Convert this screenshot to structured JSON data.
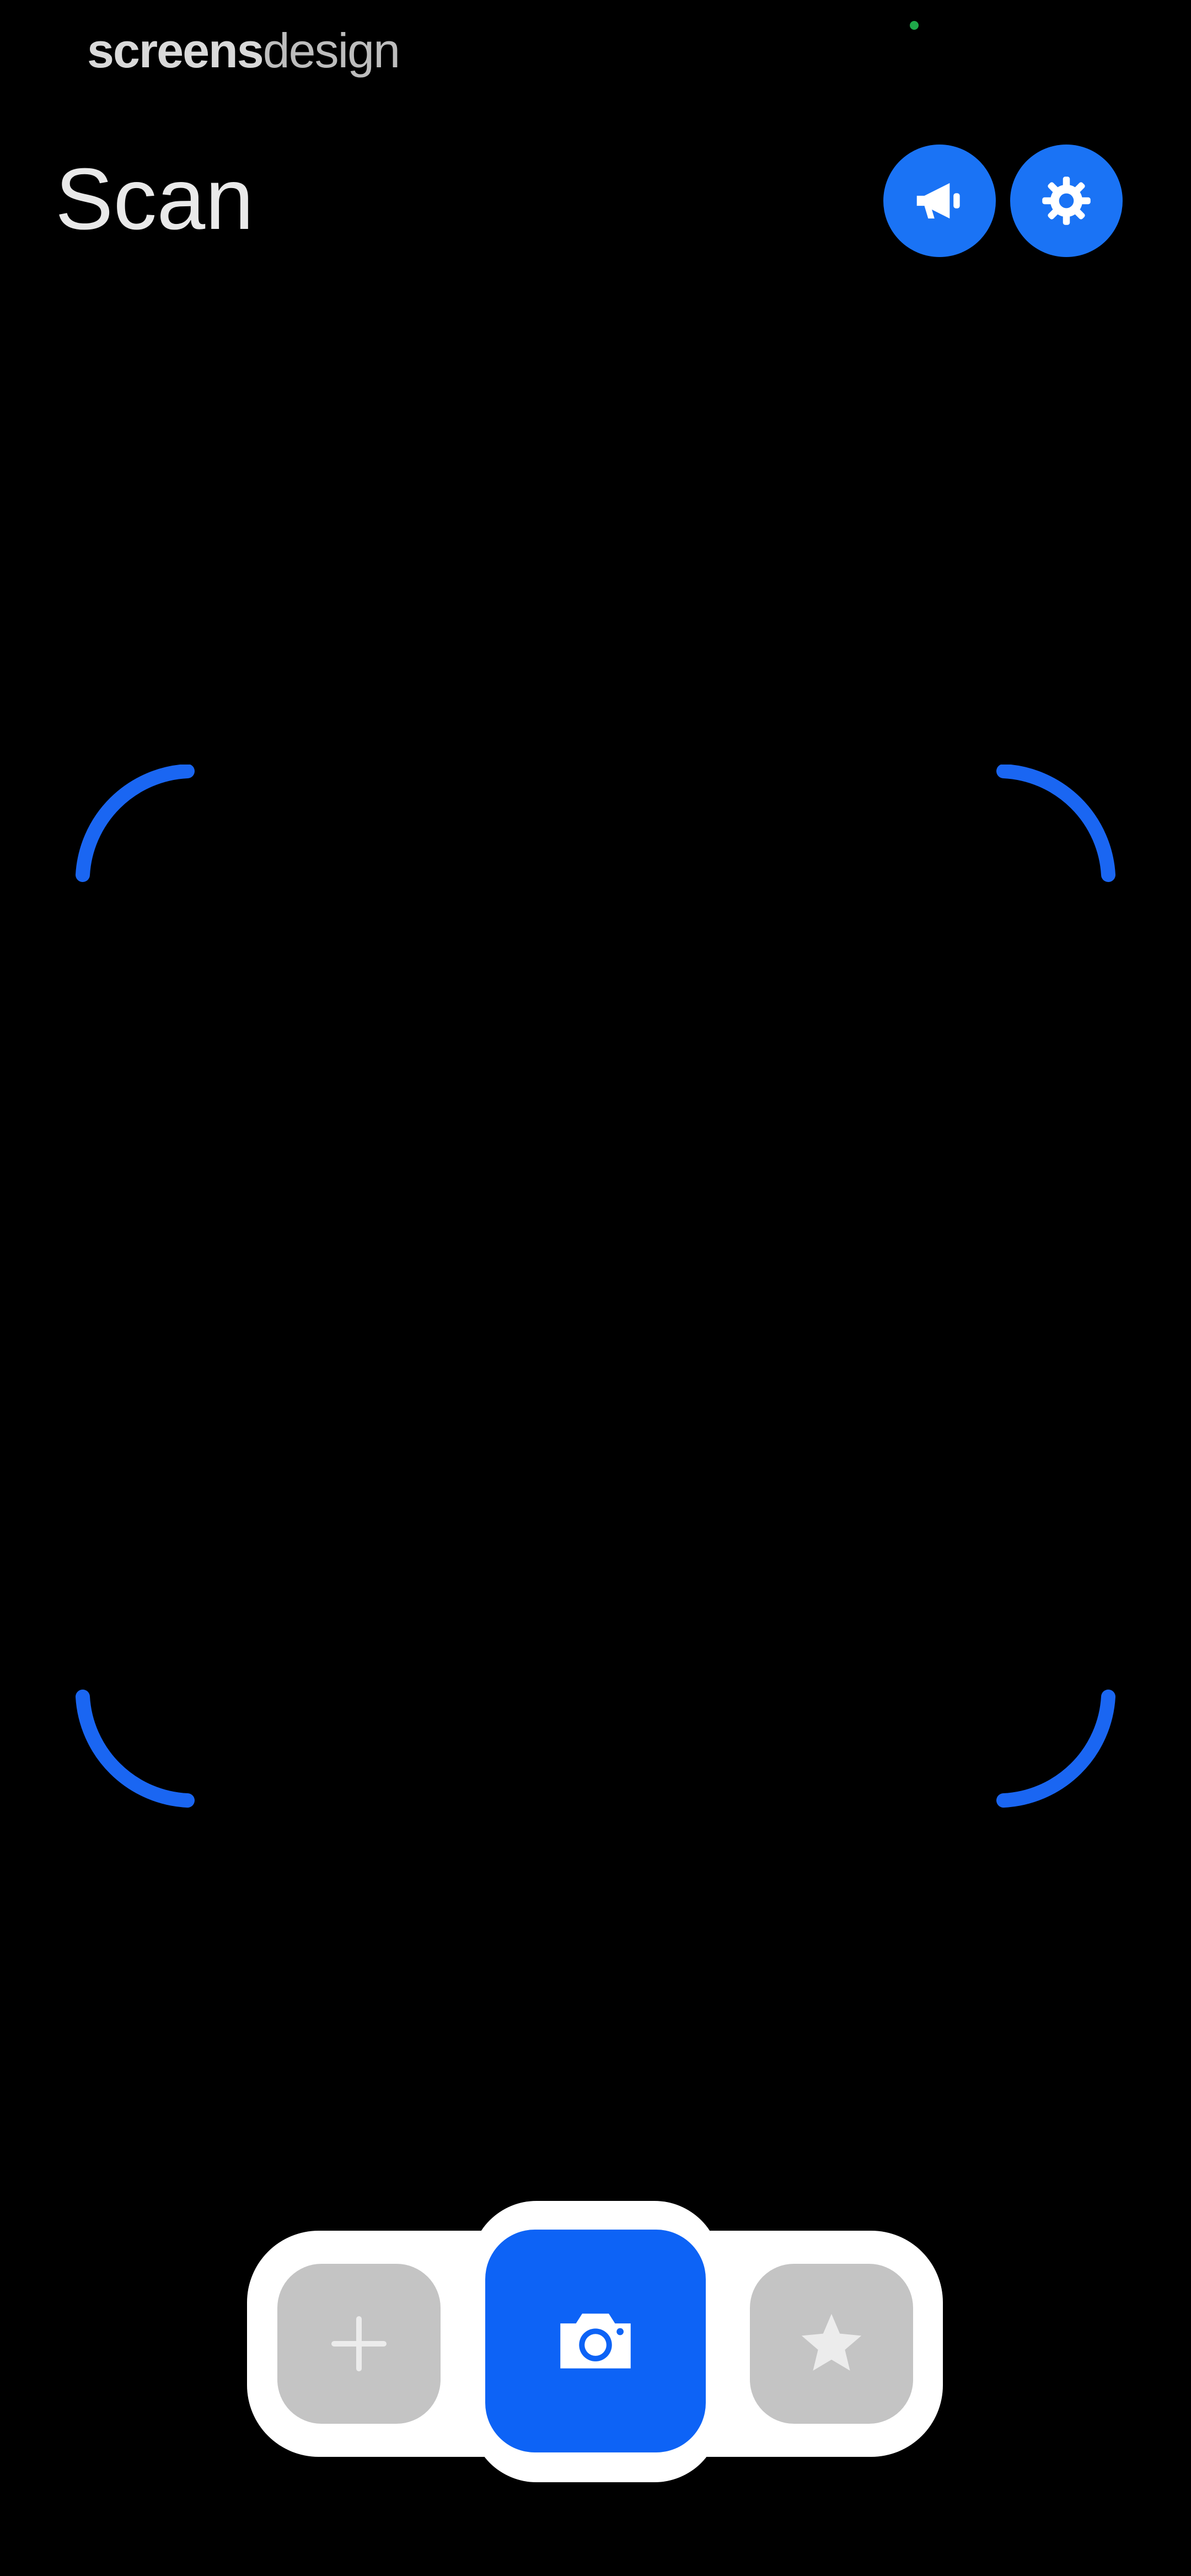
{
  "watermark": {
    "bold_part": "screens",
    "light_part": "design"
  },
  "header": {
    "title": "Scan",
    "actions": [
      {
        "name": "announcements",
        "icon": "megaphone-icon"
      },
      {
        "name": "settings",
        "icon": "gear-icon"
      }
    ]
  },
  "scanner": {
    "frame_color": "#1a66f2"
  },
  "tabbar": {
    "tabs": [
      {
        "name": "add",
        "icon": "plus-icon",
        "active": false
      },
      {
        "name": "scan",
        "icon": "camera-icon",
        "active": true
      },
      {
        "name": "favorites",
        "icon": "star-icon",
        "active": false
      }
    ]
  },
  "colors": {
    "background": "#000000",
    "accent": "#1a73f5",
    "active_tab": "#0d63f6",
    "inactive_tab": "#c4c4c4",
    "tabbar_bg": "#ffffff"
  }
}
